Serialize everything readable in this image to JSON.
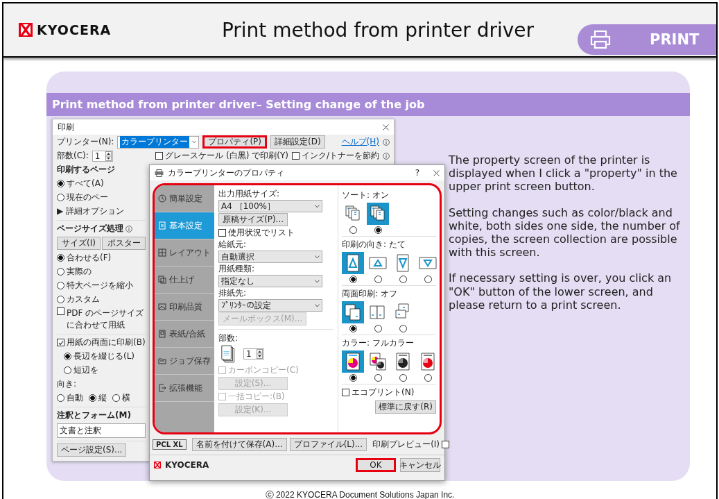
{
  "header": {
    "logo": "KYOCERA",
    "title": "Print method from printer driver",
    "badge": "PRINT"
  },
  "panel_title": "Print method from printer driver– Setting change of the job",
  "print_dialog": {
    "title": "印刷",
    "printer_label": "プリンター(N):",
    "printer": "カラープリンター",
    "buttons": [
      {
        "label": "プロパティ(P)",
        "highlighted": true
      },
      {
        "label": "詳細設定(D)",
        "highlighted": false
      }
    ],
    "help": "ヘルプ(H)",
    "copies_label": "部数(C):",
    "copies": "1",
    "options": [
      {
        "label": "グレースケール (白黒) で印刷(Y)",
        "checked": false
      },
      {
        "label": "インク/トナーを節約",
        "checked": false
      }
    ],
    "pages": {
      "title": "印刷するページ",
      "choices": [
        {
          "label": "すべて(A)",
          "selected": true
        },
        {
          "label": "現在のペー",
          "selected": false
        }
      ],
      "more": "▶ 詳細オプション"
    },
    "size": {
      "title": "ページサイズ処理",
      "buttons": [
        "サイズ(I)",
        "ポスター"
      ],
      "choices": [
        {
          "label": "合わせる(F)",
          "selected": true
        },
        {
          "label": "実際の",
          "selected": false
        },
        {
          "label": "特大ページを縮小",
          "selected": false
        },
        {
          "label": "カスタム",
          "selected": false
        }
      ],
      "fit_pdf": {
        "label": "PDF のページサイズに合わせて用紙",
        "checked": false
      }
    },
    "duplex": {
      "label": "用紙の両面に印刷(B)",
      "checked": true,
      "choices": [
        {
          "label": "長辺を綴じる(L)",
          "selected": true
        },
        {
          "label": "短辺を",
          "selected": false
        }
      ]
    },
    "orientation": {
      "label": "向き:",
      "choices": [
        {
          "label": "自動",
          "selected": false
        },
        {
          "label": "縦",
          "selected": true
        },
        {
          "label": "横",
          "selected": false
        }
      ]
    },
    "annotations": {
      "title": "注釈とフォーム(M)",
      "value": "文書と注釈"
    },
    "page_setup": "ページ設定(S)..."
  },
  "properties_dialog": {
    "title": "カラープリンターのプロパティ",
    "help": "?",
    "highlighted": true,
    "nav": [
      {
        "label": "簡単設定",
        "selected": false
      },
      {
        "label": "基本設定",
        "selected": true
      },
      {
        "label": "レイアウト",
        "selected": false
      },
      {
        "label": "仕上げ",
        "selected": false
      },
      {
        "label": "印刷品質",
        "selected": false
      },
      {
        "label": "表紙/合紙",
        "selected": false
      },
      {
        "label": "ジョブ保存",
        "selected": false
      },
      {
        "label": "拡張機能",
        "selected": false
      }
    ],
    "paper_fields": [
      {
        "kind": "select",
        "label": "出力用紙サイズ:",
        "value": "A4 ［100%］"
      },
      {
        "kind": "button",
        "label": "原稿サイズ(P)...",
        "disabled": false
      },
      {
        "kind": "checkbox",
        "label": "使用状況でリスト",
        "checked": false,
        "disabled": false
      },
      {
        "kind": "select",
        "label": "給紙元:",
        "value": "自動選択"
      },
      {
        "kind": "select",
        "label": "用紙種類:",
        "value": "指定なし"
      },
      {
        "kind": "select",
        "label": "排紙先:",
        "value": "ﾌﾟﾘﾝﾀｰの設定"
      },
      {
        "kind": "button",
        "label": "メールボックス(M)...",
        "disabled": true
      }
    ],
    "copies": {
      "label": "部数:",
      "value": "1"
    },
    "copy_fields": [
      {
        "kind": "checkbox",
        "label": "カーボンコピー(C)",
        "checked": false,
        "disabled": true
      },
      {
        "kind": "button",
        "label": "設定(S)...",
        "disabled": true
      },
      {
        "kind": "checkbox",
        "label": "一括コピー:(B)",
        "checked": false,
        "disabled": true
      },
      {
        "kind": "button",
        "label": "設定(K)...",
        "disabled": true
      }
    ],
    "groups": [
      {
        "label": "ソート: オン",
        "options": [
          {
            "selected": false
          },
          {
            "selected": true
          }
        ]
      },
      {
        "label": "印刷の向き: たて",
        "options": [
          {
            "selected": true
          },
          {
            "selected": false
          },
          {
            "selected": false
          },
          {
            "selected": false
          }
        ]
      },
      {
        "label": "両面印刷: オフ",
        "options": [
          {
            "selected": true
          },
          {
            "selected": false
          },
          {
            "selected": false
          }
        ]
      },
      {
        "label": "カラー: フルカラー",
        "options": [
          {
            "selected": true
          },
          {
            "selected": false
          },
          {
            "selected": false
          },
          {
            "selected": false
          }
        ]
      }
    ],
    "eco": {
      "label": "エコプリント(N)",
      "checked": false
    },
    "reset": "標準に戻す(R)",
    "pdl": "PCL XL",
    "buttons": [
      "名前を付けて保存(A)...",
      "プロファイル(L)..."
    ],
    "preview": {
      "label": "印刷プレビュー(I)",
      "checked": false
    },
    "logo": "KYOCERA",
    "actions": [
      {
        "label": "OK",
        "highlighted": true
      },
      {
        "label": "キャンセル",
        "highlighted": false
      }
    ]
  },
  "description": [
    "The property screen of the printer is displayed when I click a \"property\" in the upper print screen button.",
    "Setting changes such as color/black and white, both sides one side, the number of copies, the screen collection are possible with this screen.",
    "If necessary setting is over, you click an \"OK\" button of the lower screen, and please return to a print screen."
  ],
  "footer": "ⓒ 2022 KYOCERA Document Solutions Japan Inc."
}
